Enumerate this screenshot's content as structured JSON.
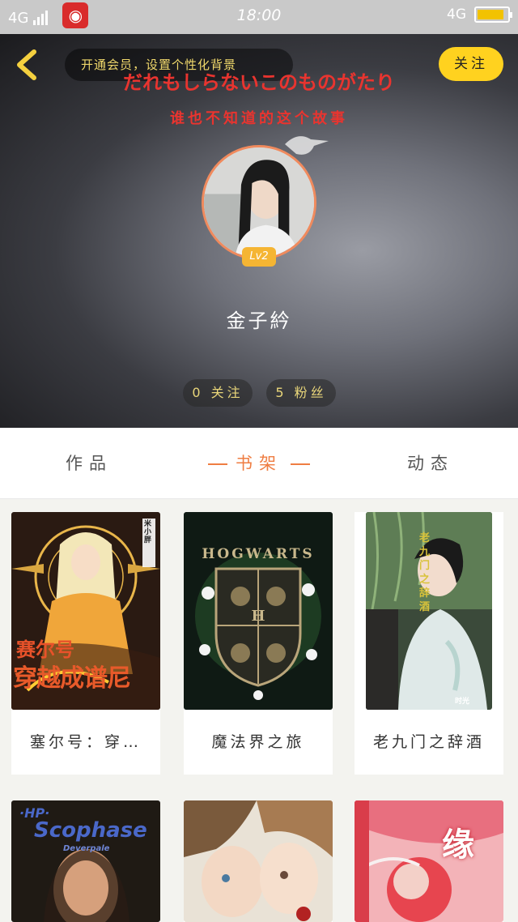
{
  "status_bar": {
    "network_left": "4G",
    "time": "18:00",
    "network_right": "4G",
    "battery_level": 0.9
  },
  "header": {
    "vip_text": "开通会员，设置个性化背景",
    "tagline_jp": "だれもしらないこのものがたり",
    "tagline_zh": "谁也不知道的这个故事",
    "follow_label": "关注",
    "level": "Lv2",
    "username": "金子紟",
    "following": "0 关注",
    "fans": "5 粉丝"
  },
  "tabs": [
    {
      "label": "作品",
      "active": false
    },
    {
      "label": "书架",
      "active": true
    },
    {
      "label": "动态",
      "active": false
    }
  ],
  "books": [
    {
      "title": "塞尔号：穿…",
      "cover_text_1": "赛尔号",
      "cover_text_2": "穿越成谱尼",
      "cover_author": "米小胖"
    },
    {
      "title": "魔法界之旅",
      "cover_text_1": "HOGWARTS",
      "cover_text_2": "H"
    },
    {
      "title": "老九门之辞酒",
      "cover_text_1": "老九门之辞酒",
      "cover_text_2": "时光"
    },
    {
      "title": "",
      "cover_text_1": "·HP·",
      "cover_text_2": "Scophase",
      "cover_author": "Deverpale"
    },
    {
      "title": "",
      "cover_text_1": ""
    },
    {
      "title": "",
      "cover_text_1": "缘"
    }
  ],
  "colors": {
    "accent": "#ef7d42",
    "follow_button": "#ffd21f",
    "tagline": "#e9342f",
    "level_badge": "#f5b533"
  }
}
